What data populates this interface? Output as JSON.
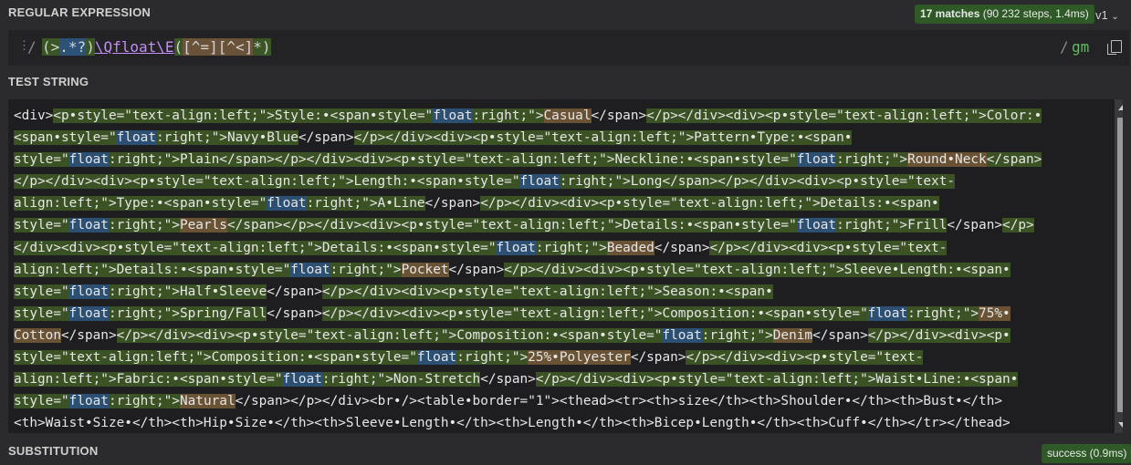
{
  "regex_section": {
    "title": "REGULAR EXPRESSION",
    "match_count": "17 matches",
    "match_detail": "(90 232 steps, 1.4ms)",
    "version": "v1",
    "delimiter_open": "/",
    "delimiter_close": "/",
    "flags": "gm",
    "tokens": [
      {
        "text": "(",
        "style": "rg"
      },
      {
        "text": ">",
        "style": "rg"
      },
      {
        "text": ".*?",
        "style": "rq"
      },
      {
        "text": ")",
        "style": "rg"
      },
      {
        "text": "\\Qfloat\\E",
        "style": "rp"
      },
      {
        "text": "(",
        "style": "rg"
      },
      {
        "text": "[^=]",
        "style": "rc"
      },
      {
        "text": "[^<]",
        "style": "rc"
      },
      {
        "text": "*",
        "style": "rg"
      },
      {
        "text": ")",
        "style": "rg"
      }
    ]
  },
  "test_section": {
    "title": "TEST STRING",
    "lines": [
      [
        {
          "t": "<div>",
          "s": ""
        },
        {
          "t": "<p•style=\"text-align:left;\">Style:•<span•style=\"",
          "s": "m"
        },
        {
          "t": "float",
          "s": "mq"
        },
        {
          "t": ":right;\">",
          "s": "m"
        },
        {
          "t": "Casual",
          "s": "mc"
        },
        {
          "t": "</span>",
          "s": ""
        },
        {
          "t": "</p></div><div><p•style=\"text-align:left;\">Color:•",
          "s": "m"
        }
      ],
      [
        {
          "t": "<span•style=\"",
          "s": "m"
        },
        {
          "t": "float",
          "s": "mq"
        },
        {
          "t": ":right;\">Navy•Blue",
          "s": "m"
        },
        {
          "t": "</span>",
          "s": ""
        },
        {
          "t": "</p></div><div><p•style=\"text-align:left;\">Pattern•Type:•<span•",
          "s": "m"
        }
      ],
      [
        {
          "t": "style=\"",
          "s": "m"
        },
        {
          "t": "float",
          "s": "mq"
        },
        {
          "t": ":right;\">Plain",
          "s": "m"
        },
        {
          "t": "</span></p></div><div><p•style=\"text-align:left;\">Neckline:•<span•style=\"",
          "s": "m"
        },
        {
          "t": "float",
          "s": "mq"
        },
        {
          "t": ":right;\">",
          "s": "m"
        },
        {
          "t": "Round•Neck",
          "s": "mc"
        },
        {
          "t": "</span>",
          "s": "m"
        }
      ],
      [
        {
          "t": "</p></div><div><p•style=\"text-align:left;\">Length:•<span•style=\"",
          "s": "m"
        },
        {
          "t": "float",
          "s": "mq"
        },
        {
          "t": ":right;\">Long",
          "s": "m"
        },
        {
          "t": "</span></p></div><div><p•style=\"text-",
          "s": "m"
        }
      ],
      [
        {
          "t": "align:left;\">Type:•<span•style=\"",
          "s": "m"
        },
        {
          "t": "float",
          "s": "mq"
        },
        {
          "t": ":right;\">A•Line",
          "s": "m"
        },
        {
          "t": "</span>",
          "s": ""
        },
        {
          "t": "</p></div><div><p•style=\"text-align:left;\">Details:•<span•",
          "s": "m"
        }
      ],
      [
        {
          "t": "style=\"",
          "s": "m"
        },
        {
          "t": "float",
          "s": "mq"
        },
        {
          "t": ":right;\">",
          "s": "m"
        },
        {
          "t": "Pearls",
          "s": "mc"
        },
        {
          "t": "</span></p></div><div><p•style=\"text-align:left;\">Details:•<span•style=\"",
          "s": "m"
        },
        {
          "t": "float",
          "s": "mq"
        },
        {
          "t": ":right;\">Frill",
          "s": "m"
        },
        {
          "t": "</span>",
          "s": ""
        },
        {
          "t": "</p>",
          "s": "m"
        }
      ],
      [
        {
          "t": "</div><div><p•style=\"text-align:left;\">Details:•<span•style=\"",
          "s": "m"
        },
        {
          "t": "float",
          "s": "mq"
        },
        {
          "t": ":right;\">",
          "s": "m"
        },
        {
          "t": "Beaded",
          "s": "mc"
        },
        {
          "t": "</span>",
          "s": ""
        },
        {
          "t": "</p></div><div><p•style=\"text-",
          "s": "m"
        }
      ],
      [
        {
          "t": "align:left;\">Details:•<span•style=\"",
          "s": "m"
        },
        {
          "t": "float",
          "s": "mq"
        },
        {
          "t": ":right;\">",
          "s": "m"
        },
        {
          "t": "Pocket",
          "s": "mc"
        },
        {
          "t": "</span>",
          "s": ""
        },
        {
          "t": "</p></div><div><p•style=\"text-align:left;\">Sleeve•Length:•<span•",
          "s": "m"
        }
      ],
      [
        {
          "t": "style=\"",
          "s": "m"
        },
        {
          "t": "float",
          "s": "mq"
        },
        {
          "t": ":right;\">Half•Sleeve",
          "s": "m"
        },
        {
          "t": "</span>",
          "s": ""
        },
        {
          "t": "</p></div><div><p•style=\"text-align:left;\">Season:•<span•",
          "s": "m"
        }
      ],
      [
        {
          "t": "style=\"",
          "s": "m"
        },
        {
          "t": "float",
          "s": "mq"
        },
        {
          "t": ":right;\">Spring/Fall",
          "s": "m"
        },
        {
          "t": "</span>",
          "s": ""
        },
        {
          "t": "</p></div><div><p•style=\"text-align:left;\">Composition:•<span•style=\"",
          "s": "m"
        },
        {
          "t": "float",
          "s": "mq"
        },
        {
          "t": ":right;\">",
          "s": "m"
        },
        {
          "t": "75%•",
          "s": "mc"
        }
      ],
      [
        {
          "t": "Cotton",
          "s": "mc"
        },
        {
          "t": "</span>",
          "s": ""
        },
        {
          "t": "</p></div><div><p•style=\"text-align:left;\">Composition:•<span•style=\"",
          "s": "m"
        },
        {
          "t": "float",
          "s": "mq"
        },
        {
          "t": ":right;\">",
          "s": "m"
        },
        {
          "t": "Denim",
          "s": "mc"
        },
        {
          "t": "</span>",
          "s": ""
        },
        {
          "t": "</p></div><div><p•",
          "s": "m"
        }
      ],
      [
        {
          "t": "style=\"text-align:left;\">Composition:•<span•style=\"",
          "s": "m"
        },
        {
          "t": "float",
          "s": "mq"
        },
        {
          "t": ":right;\">",
          "s": "m"
        },
        {
          "t": "25%•Polyester",
          "s": "mc"
        },
        {
          "t": "</span>",
          "s": ""
        },
        {
          "t": "</p></div><div><p•style=\"text-",
          "s": "m"
        }
      ],
      [
        {
          "t": "align:left;\">Fabric:•<span•style=\"",
          "s": "m"
        },
        {
          "t": "float",
          "s": "mq"
        },
        {
          "t": ":right;\">Non-Stretch",
          "s": "m"
        },
        {
          "t": "</span>",
          "s": ""
        },
        {
          "t": "</p></div><div><p•style=\"text-align:left;\">Waist•Line:•<span•",
          "s": "m"
        }
      ],
      [
        {
          "t": "style=\"",
          "s": "m"
        },
        {
          "t": "float",
          "s": "mq"
        },
        {
          "t": ":right;\">",
          "s": "m"
        },
        {
          "t": "Natural",
          "s": "mc"
        },
        {
          "t": "</span></p></div><br•/><table•border=\"1\"><thead><tr><th>size</th><th>Shoulder•</th><th>Bust•</th>",
          "s": ""
        }
      ],
      [
        {
          "t": "<th>Waist•Size•</th><th>Hip•Size•</th><th>Sleeve•Length•</th><th>Length•</th><th>Bicep•Length•</th><th>Cuff•</th></tr></thead>",
          "s": ""
        }
      ]
    ]
  },
  "substitution_section": {
    "title": "SUBSTITUTION",
    "status": "success (0.9ms)"
  }
}
